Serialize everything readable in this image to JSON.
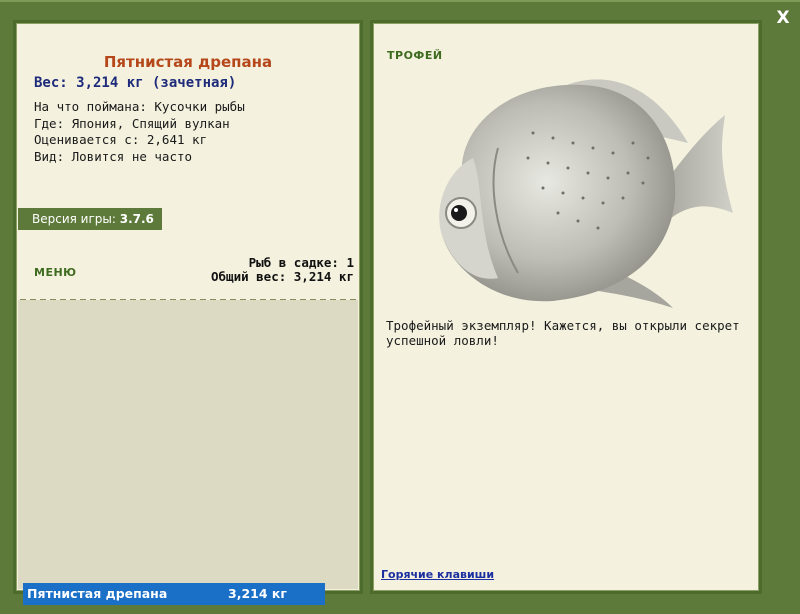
{
  "window": {
    "close_label": "X"
  },
  "fish": {
    "name": "Пятнистая дрепана",
    "weight_line": "Вес: 3,214 кг (зачетная)",
    "info": [
      "На что поймана: Кусочки рыбы",
      "Где: Япония, Спящий вулкан",
      "Оценивается с: 2,641 кг",
      "Вид: Ловится не часто"
    ]
  },
  "version": {
    "label": "Версия игры:",
    "value": "3.7.6"
  },
  "menu": {
    "label": "МЕНЮ"
  },
  "stats": {
    "fish_count": "Рыб в садке: 1",
    "total_weight": "Общий вес: 3,214 кг"
  },
  "catch_list": [
    {
      "name": "Пятнистая дрепана",
      "weight": "3,214 кг"
    }
  ],
  "trophy": {
    "label": "ТРОФЕЙ",
    "text": "Трофейный экземпляр! Кажется, вы открыли секрет успешной ловли!"
  },
  "hotkeys": {
    "label": "Горячие клавиши"
  },
  "colors": {
    "background": "#5e7a3a",
    "panel": "#f4f2df",
    "title": "#b5471a",
    "weight": "#1e2b7a",
    "selection": "#1a6fc7"
  },
  "icons": {
    "close": "close-icon",
    "fish": "fish-image"
  }
}
